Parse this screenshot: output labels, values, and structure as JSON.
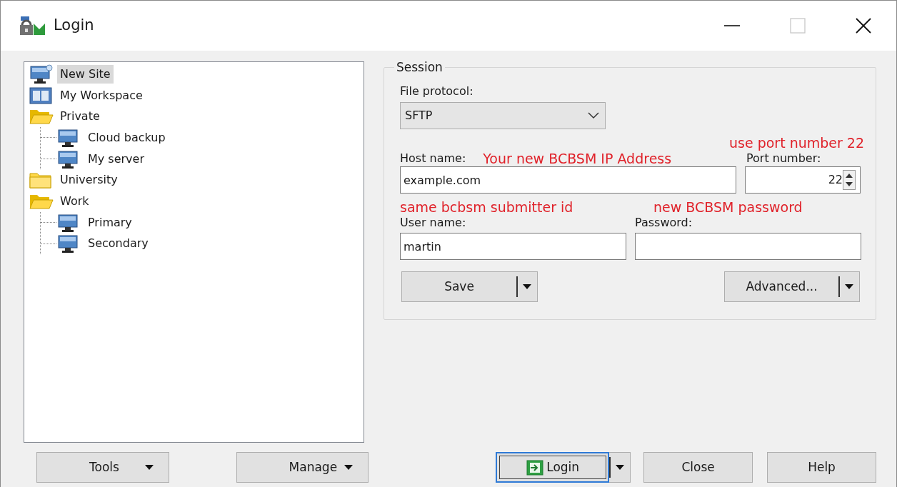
{
  "window": {
    "title": "Login"
  },
  "sites": [
    {
      "label": "New Site",
      "kind": "new_site",
      "selected": true
    },
    {
      "label": "My Workspace",
      "kind": "workspace",
      "selected": false
    },
    {
      "label": "Private",
      "kind": "folder",
      "expanded": true,
      "selected": false,
      "children": [
        {
          "label": "Cloud backup",
          "kind": "site",
          "selected": false
        },
        {
          "label": "My server",
          "kind": "site",
          "selected": false
        }
      ]
    },
    {
      "label": "University",
      "kind": "folder",
      "expanded": false,
      "selected": false
    },
    {
      "label": "Work",
      "kind": "folder",
      "expanded": true,
      "selected": false,
      "children": [
        {
          "label": "Primary",
          "kind": "site",
          "selected": false
        },
        {
          "label": "Secondary",
          "kind": "site",
          "selected": false
        }
      ]
    }
  ],
  "session": {
    "title": "Session",
    "file_protocol": {
      "label": "File protocol:",
      "value": "SFTP"
    },
    "host_name": {
      "label": "Host name:",
      "value": "example.com",
      "annotation": "Your new BCBSM IP Address"
    },
    "port_number": {
      "label": "Port number:",
      "value": "22",
      "annotation": "use port number 22"
    },
    "user_name": {
      "label": "User name:",
      "value": "martin",
      "annotation": "same bcbsm submitter id"
    },
    "password": {
      "label": "Password:",
      "annotation": "new BCBSM password"
    },
    "save_button": "Save",
    "advanced_button": "Advanced..."
  },
  "bottom_buttons": [
    {
      "label": "Tools",
      "kind": "dropdown",
      "default": false
    },
    {
      "label": "Manage",
      "kind": "dropdown",
      "default": false
    },
    {
      "label": "Login",
      "kind": "split",
      "default": true
    },
    {
      "label": "Close",
      "kind": "plain",
      "default": false
    },
    {
      "label": "Help",
      "kind": "plain",
      "default": false
    }
  ]
}
